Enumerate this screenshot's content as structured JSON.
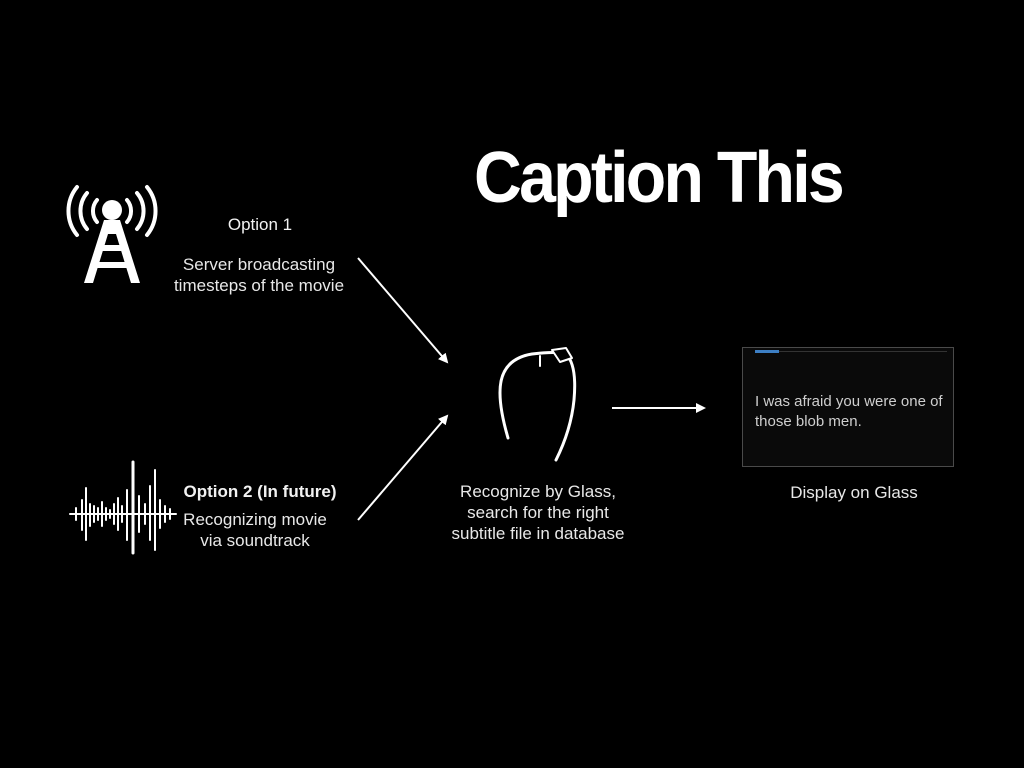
{
  "title": "Caption This",
  "option1": {
    "heading": "Option 1",
    "description": "Server broadcasting timesteps of the movie",
    "icon": "broadcast-tower-icon"
  },
  "option2": {
    "heading": "Option 2 (In future)",
    "description": "Recognizing movie via soundtrack",
    "icon": "sound-waveform-icon"
  },
  "glass": {
    "description": "Recognize by Glass, search for the right subtitle file in database",
    "icon": "google-glass-icon"
  },
  "display": {
    "label": "Display on Glass",
    "screen_text": "I was afraid you were one of those blob men."
  },
  "colors": {
    "background": "#000000",
    "foreground": "#ffffff",
    "progress_accent": "#3d7fc4"
  }
}
